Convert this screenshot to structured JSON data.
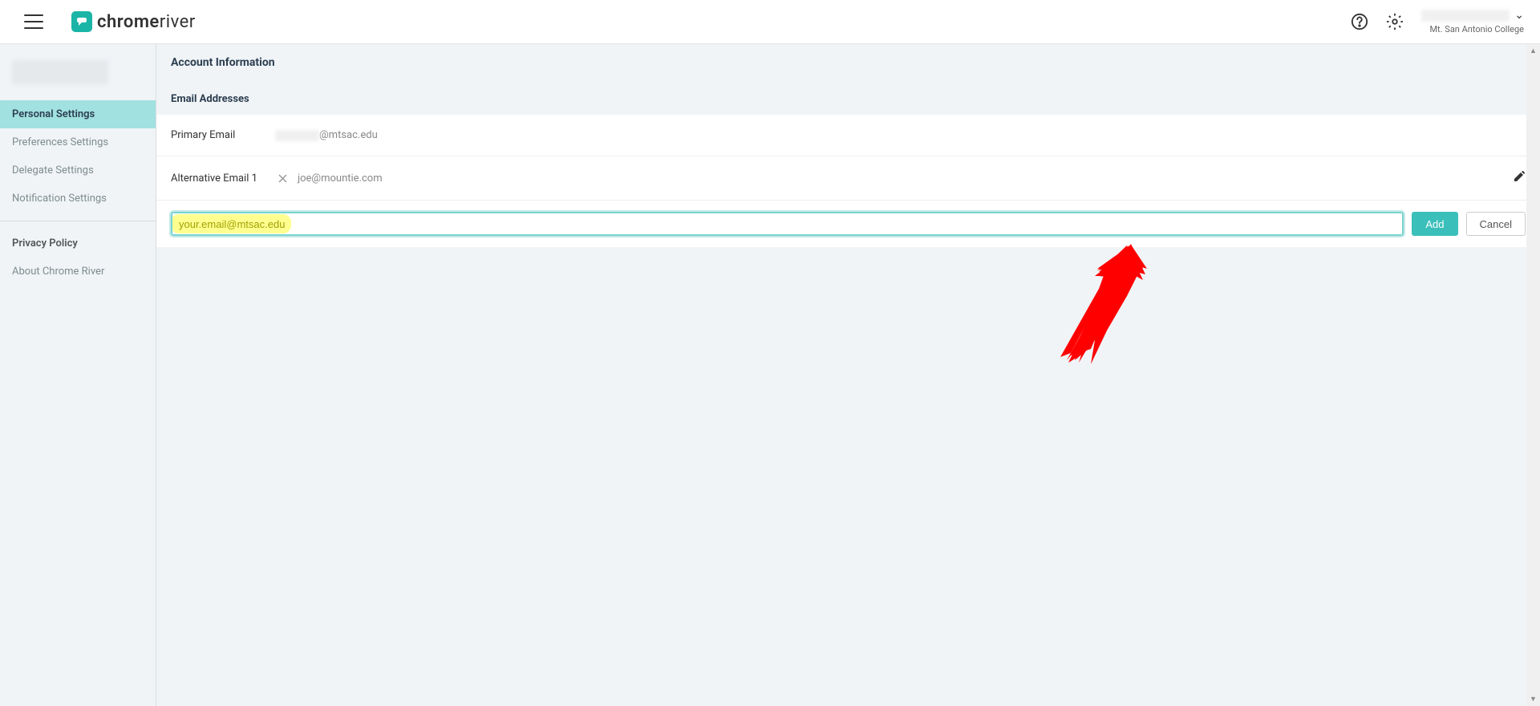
{
  "header": {
    "logo_brand_left": "chrome",
    "logo_brand_right": "river",
    "org_name": "Mt. San Antonio College"
  },
  "sidebar": {
    "items": [
      {
        "label": "Personal Settings",
        "active": true
      },
      {
        "label": "Preferences Settings",
        "active": false
      },
      {
        "label": "Delegate Settings",
        "active": false
      },
      {
        "label": "Notification Settings",
        "active": false
      }
    ],
    "footer_items": [
      {
        "label": "Privacy Policy"
      },
      {
        "label": "About Chrome River"
      }
    ]
  },
  "main": {
    "account_info_title": "Account Information",
    "email_section_title": "Email Addresses",
    "primary_email_label": "Primary Email",
    "primary_email_suffix": "@mtsac.edu",
    "alt_email_label": "Alternative Email 1",
    "alt_email_value": "joe@mountie.com",
    "new_email_value": "your.email@mtsac.edu",
    "add_btn": "Add",
    "cancel_btn": "Cancel"
  }
}
